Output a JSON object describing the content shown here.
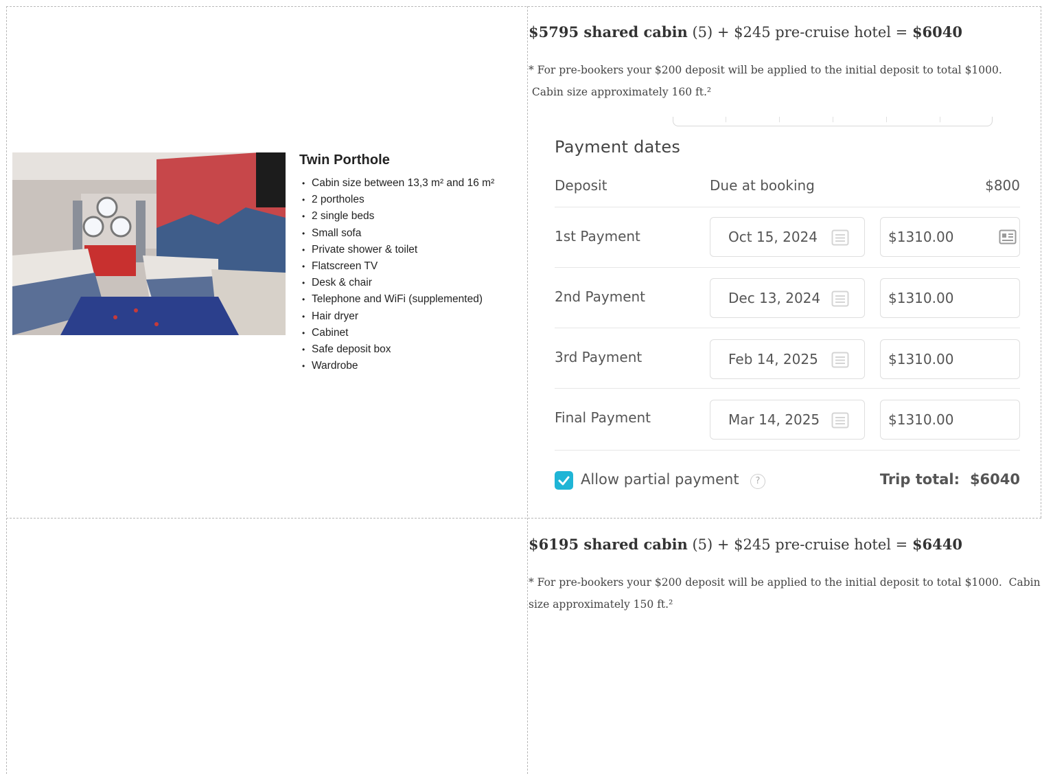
{
  "cabin": {
    "title": "Twin Porthole",
    "features": [
      "Cabin size between 13,3 m² and 16 m²",
      "2 portholes",
      "2 single beds",
      "Small sofa",
      "Private shower & toilet",
      "Flatscreen TV",
      "Desk & chair",
      "Telephone and WiFi (supplemented)",
      "Hair dryer",
      "Cabinet",
      "Safe deposit box",
      "Wardrobe"
    ]
  },
  "row1": {
    "price_bold": "$5795 shared cabin",
    "price_mid": " (5) + $245 pre-cruise hotel = ",
    "price_total": "$6040",
    "note_line1": "* For pre-bookers your $200 deposit will be applied to the initial deposit to total $1000.",
    "note_line2": " Cabin size approximately 160 ft.²"
  },
  "payment": {
    "heading": "Payment dates",
    "deposit": {
      "label": "Deposit",
      "due": "Due at booking",
      "amount": "$800"
    },
    "rows": [
      {
        "label": "1st Payment",
        "date": "Oct 15, 2024",
        "amount": "$1310.00"
      },
      {
        "label": "2nd Payment",
        "date": "Dec 13, 2024",
        "amount": "$1310.00"
      },
      {
        "label": "3rd Payment",
        "date": "Feb 14, 2025",
        "amount": "$1310.00"
      },
      {
        "label": "Final Payment",
        "date": "Mar 14, 2025",
        "amount": "$1310.00"
      }
    ],
    "partial_label": "Allow partial payment",
    "partial_checked": true,
    "help_glyph": "?",
    "trip_total_label": "Trip total:",
    "trip_total_value": "$6040",
    "accent_color": "#1fb5d6"
  },
  "row2": {
    "price_bold": "$6195 shared cabin",
    "price_mid": " (5) + $245 pre-cruise hotel = ",
    "price_total": "$6440",
    "note_line1": "* For pre-bookers your $200 deposit will be applied to the initial deposit to total $1000.  Cabin",
    "note_line2": "size approximately 150 ft.²"
  }
}
